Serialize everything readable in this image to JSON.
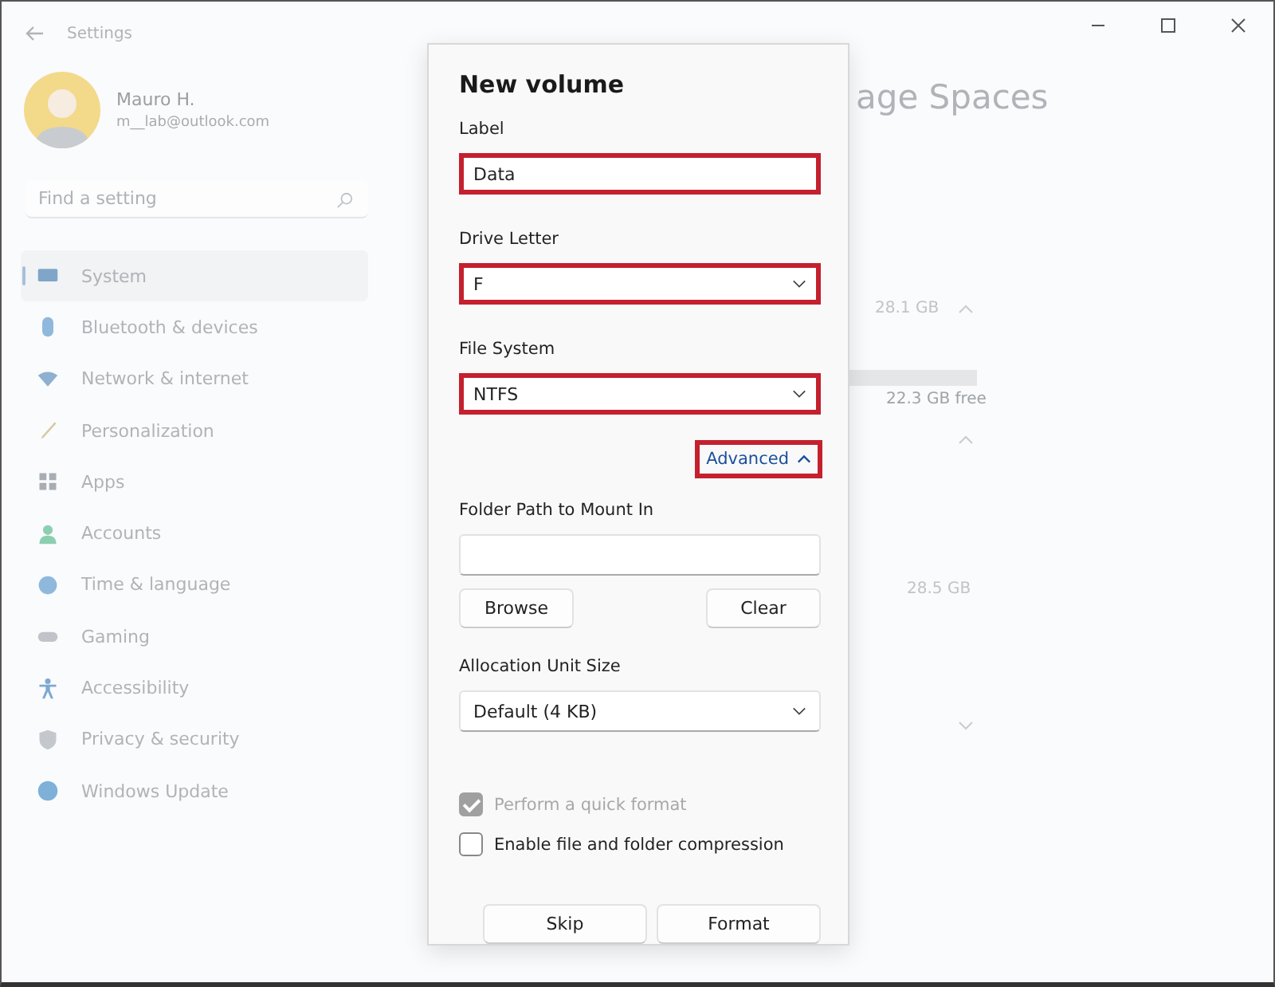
{
  "window": {
    "title": "Settings"
  },
  "user": {
    "name": "Mauro H.",
    "email": "m__lab@outlook.com"
  },
  "search": {
    "placeholder": "Find a setting"
  },
  "sidebar": {
    "items": [
      {
        "label": "System",
        "color": "#7fa6c8",
        "selected": true
      },
      {
        "label": "Bluetooth & devices",
        "color": "#8fb8dc",
        "selected": false
      },
      {
        "label": "Network & internet",
        "color": "#8fb0d0",
        "selected": false
      },
      {
        "label": "Personalization",
        "color": "#d8c8a0",
        "selected": false
      },
      {
        "label": "Apps",
        "color": "#a8adb3",
        "selected": false
      },
      {
        "label": "Accounts",
        "color": "#8ccfb0",
        "selected": false
      },
      {
        "label": "Time & language",
        "color": "#8fb8dc",
        "selected": false
      },
      {
        "label": "Gaming",
        "color": "#c0c4c8",
        "selected": false
      },
      {
        "label": "Accessibility",
        "color": "#7fa8d0",
        "selected": false
      },
      {
        "label": "Privacy & security",
        "color": "#c4c8cc",
        "selected": false
      },
      {
        "label": "Windows Update",
        "color": "#7fb0d8",
        "selected": false
      }
    ]
  },
  "background": {
    "heading_right": "age Spaces",
    "sizes": [
      "28.1 GB",
      "22.3 GB free",
      "28.5 GB"
    ]
  },
  "dialog": {
    "title": "New volume",
    "fields": [
      {
        "kind": "text",
        "label": "Label",
        "value": "Data",
        "highlighted": true
      },
      {
        "kind": "select",
        "label": "Drive Letter",
        "value": "F",
        "highlighted": true
      },
      {
        "kind": "select",
        "label": "File System",
        "value": "NTFS",
        "highlighted": true
      }
    ],
    "advanced": {
      "label": "Advanced",
      "expanded": true,
      "highlighted": true
    },
    "folder_path": {
      "label": "Folder Path to Mount In",
      "buttons": [
        "Browse",
        "Clear"
      ]
    },
    "allocation": {
      "label": "Allocation Unit Size",
      "value": "Default (4 KB)"
    },
    "options": [
      {
        "label": "Perform a quick format",
        "checked": true,
        "disabled": true
      },
      {
        "label": "Enable file and folder compression",
        "checked": false,
        "disabled": false
      }
    ],
    "buttons": [
      "Skip",
      "Format"
    ]
  }
}
